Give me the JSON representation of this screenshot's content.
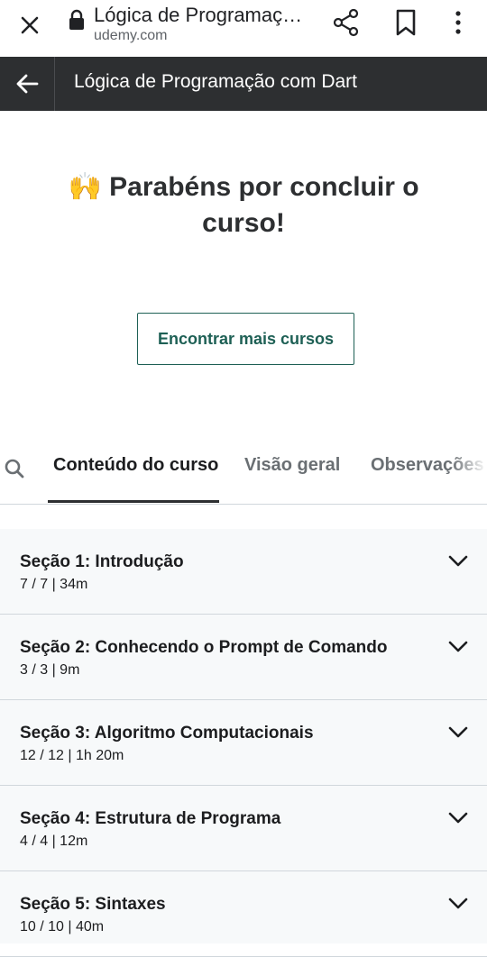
{
  "browser": {
    "page_title": "Lógica de Programaç…",
    "domain": "udemy.com"
  },
  "header": {
    "course_title": "Lógica de Programação com Dart"
  },
  "congrats": {
    "emoji": "🙌",
    "message": "Parabéns por concluir o curso!"
  },
  "find_courses_label": "Encontrar mais cursos",
  "tabs": [
    {
      "label": "Conteúdo do curso",
      "active": true
    },
    {
      "label": "Visão geral",
      "active": false
    },
    {
      "label": "Observações",
      "active": false
    }
  ],
  "sections": [
    {
      "title": "Seção 1: Introdução",
      "meta": "7 / 7 | 34m"
    },
    {
      "title": "Seção 2: Conhecendo o Prompt de Comando",
      "meta": "3 / 3 | 9m"
    },
    {
      "title": "Seção 3: Algoritmo Computacionais",
      "meta": "12 / 12 | 1h 20m"
    },
    {
      "title": "Seção 4: Estrutura de Programa",
      "meta": "4 / 4 | 12m"
    },
    {
      "title": "Seção 5: Sintaxes",
      "meta": "10 / 10 | 40m"
    }
  ],
  "colors": {
    "header_bg": "#2d2f31",
    "accent": "#1e6055",
    "section_bg": "#f7f9fa"
  }
}
